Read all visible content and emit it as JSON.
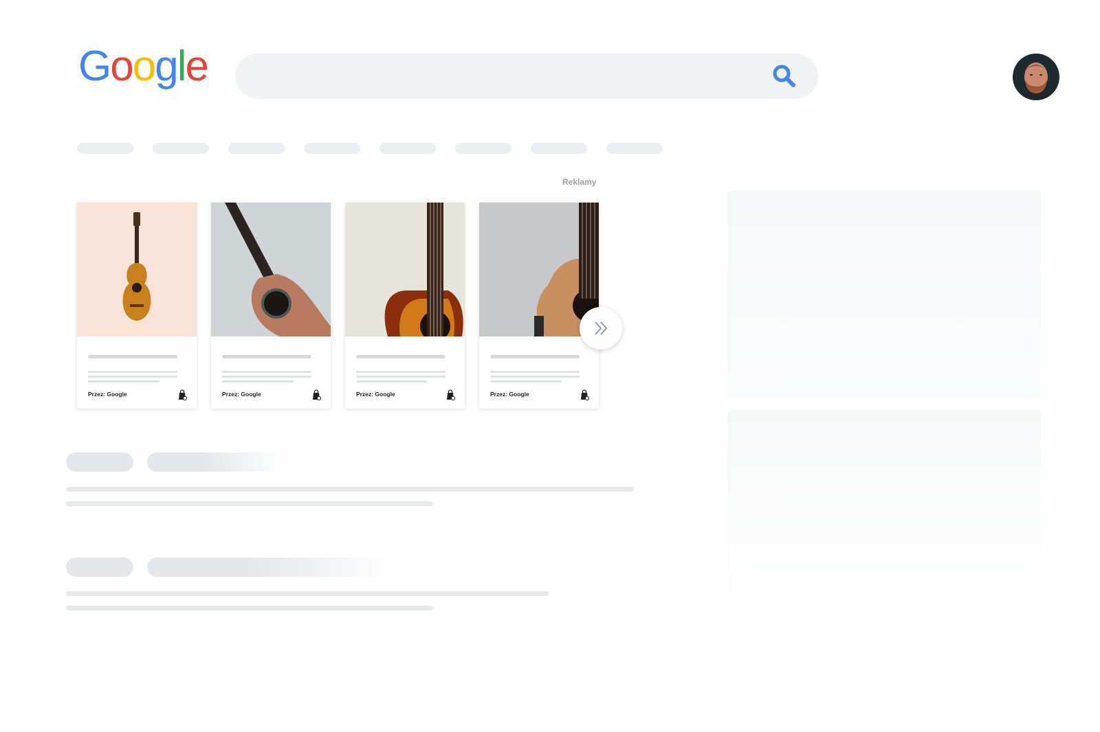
{
  "logo": {
    "letters": [
      "G",
      "o",
      "o",
      "g",
      "l",
      "e"
    ],
    "colors": [
      "#4285F4",
      "#EA4335",
      "#FBBC05",
      "#4285F4",
      "#34A853",
      "#EA4335"
    ]
  },
  "search": {
    "value": "",
    "icon": "search-icon",
    "icon_color": "#4285F4"
  },
  "profile": {
    "icon": "avatar"
  },
  "tabs_count": 8,
  "ads": {
    "label": "Reklamy",
    "products": [
      {
        "byline": "Przez: Google",
        "image": "classical-guitar-on-peach"
      },
      {
        "byline": "Przez: Google",
        "image": "ukulele-on-grey"
      },
      {
        "byline": "Przez: Google",
        "image": "sunburst-acoustic-guitar"
      },
      {
        "byline": "Przez: Google",
        "image": "natural-acoustic-guitar"
      }
    ],
    "next_icon": "double-chevron-right-icon"
  }
}
